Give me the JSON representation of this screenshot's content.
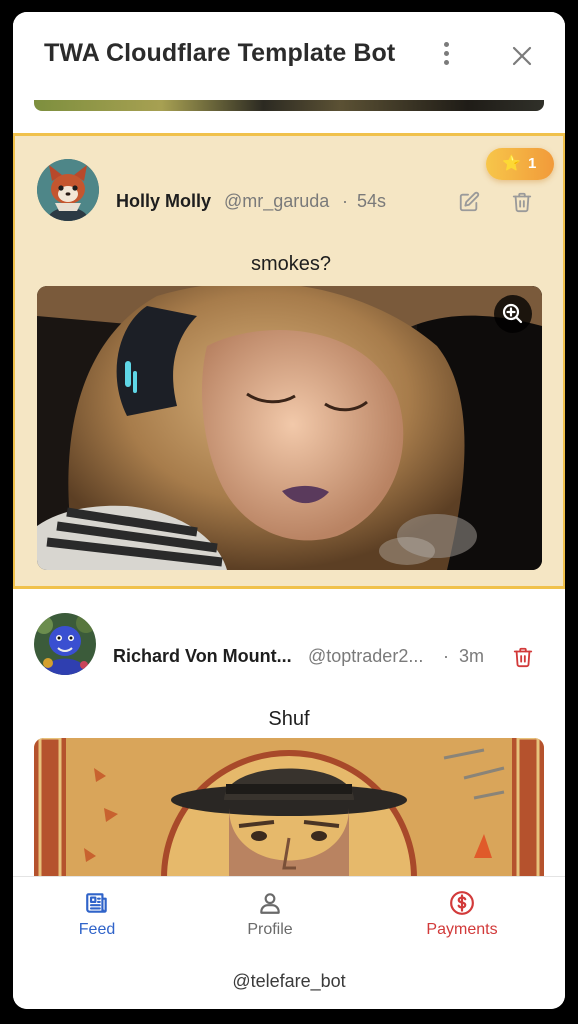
{
  "header": {
    "title": "TWA Cloudflare Template Bot"
  },
  "posts": [
    {
      "author_name": "Holly Molly",
      "author_handle": "@mr_garuda",
      "separator": "·",
      "time": "54s",
      "text": "smokes?",
      "star_count": "1",
      "star_glyph": "⭐"
    },
    {
      "author_name": "Richard Von Mount...",
      "author_handle": "@toptrader2...",
      "separator": "·",
      "time": "3m",
      "text": "Shuf"
    }
  ],
  "tabs": [
    {
      "label": "Feed",
      "color": "#2f63c9"
    },
    {
      "label": "Profile",
      "color": "#6a6a6a"
    },
    {
      "label": "Payments",
      "color": "#d23a3a"
    }
  ],
  "footer": {
    "bot_handle": "@telefare_bot"
  },
  "colors": {
    "highlight_bg": "#f5e6c4",
    "highlight_border": "#f0c14b",
    "delete_red": "#d23a3a",
    "muted_icon": "#9a9a9a"
  }
}
